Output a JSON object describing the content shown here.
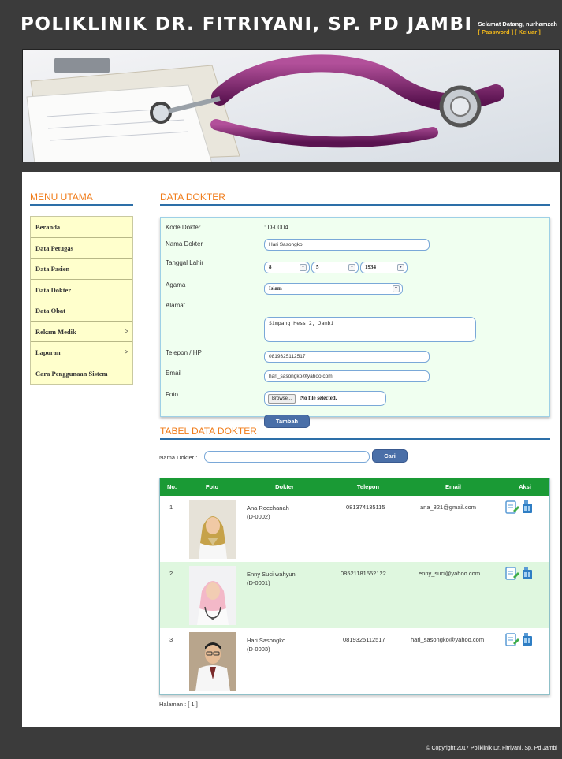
{
  "header": {
    "title": "POLIKLINIK DR. FITRIYANI, SP. PD JAMBI",
    "welcome": "Selamat Datang, nurhamzah",
    "links": "[ Password ] [ Keluar ]"
  },
  "sidebar": {
    "title": "MENU UTAMA",
    "items": [
      {
        "label": "Beranda",
        "arrow": ""
      },
      {
        "label": "Data Petugas",
        "arrow": ""
      },
      {
        "label": "Data Pasien",
        "arrow": ""
      },
      {
        "label": "Data Dokter",
        "arrow": ""
      },
      {
        "label": "Data Obat",
        "arrow": ""
      },
      {
        "label": "Rekam Medik",
        "arrow": ">"
      },
      {
        "label": "Laporan",
        "arrow": ">"
      },
      {
        "label": "Cara Penggunaan Sistem",
        "arrow": ""
      }
    ]
  },
  "form": {
    "title": "DATA DOKTER",
    "kode_label": "Kode Dokter",
    "kode_value": ": D-0004",
    "nama_label": "Nama Dokter",
    "nama_value": "Hari Sasongko",
    "tgl_label": "Tanggal Lahir",
    "tgl_day": "8",
    "tgl_month": "5",
    "tgl_year": "1934",
    "agama_label": "Agama",
    "agama_value": "Islam",
    "alamat_label": "Alamat",
    "alamat_value": "Simpang Hess 2, Jambi",
    "telp_label": "Telepon / HP",
    "telp_value": "0819325112517",
    "email_label": "Email",
    "email_value": "hari_sasongko@yahoo.com",
    "foto_label": "Foto",
    "browse_label": "Browse...",
    "file_text": "No file selected.",
    "submit_label": "Tambah"
  },
  "table_section": {
    "title": "TABEL DATA DOKTER",
    "search_label": "Nama Dokter :",
    "search_value": "",
    "search_button": "Cari",
    "headers": [
      "No.",
      "Foto",
      "Dokter",
      "Telepon",
      "Email",
      "Aksi"
    ],
    "rows": [
      {
        "no": "1",
        "nama": "Ana Roechanah",
        "kode": "(D-0002)",
        "telepon": "081374135115",
        "email": "ana_821@gmail.com"
      },
      {
        "no": "2",
        "nama": "Enny Suci wahyuni",
        "kode": "(D-0001)",
        "telepon": "08521181552122",
        "email": "enny_suci@yahoo.com"
      },
      {
        "no": "3",
        "nama": "Hari Sasongko",
        "kode": "(D-0003)",
        "telepon": "0819325112517",
        "email": "hari_sasongko@yahoo.com"
      }
    ],
    "pagination": "Halaman : [ 1 ]"
  },
  "footer": {
    "copyright": "© Copyright 2017 Poliklinik Dr. Fitriyani, Sp. Pd Jambi"
  },
  "icons": {
    "edit": "edit-icon",
    "delete": "delete-icon"
  },
  "colors": {
    "accent_orange": "#f07c1a",
    "table_header_green": "#1a9a35",
    "button_blue": "#4a6fa8",
    "menu_yellow": "#ffffcc"
  }
}
